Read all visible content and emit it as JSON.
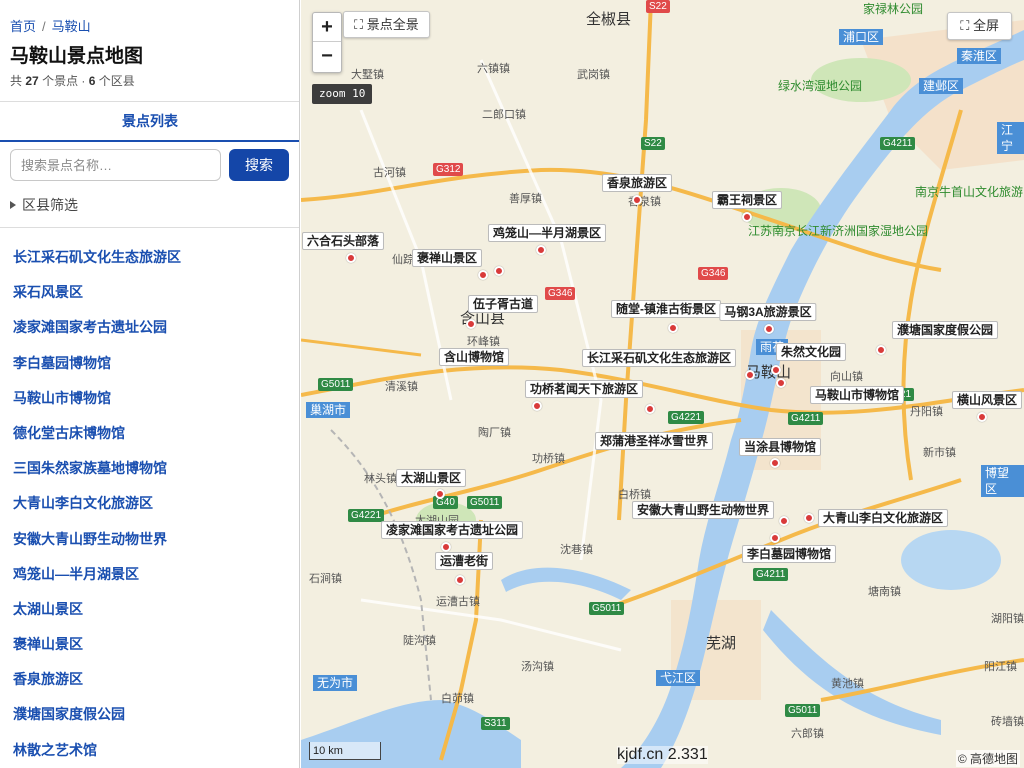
{
  "breadcrumb": {
    "home": "首页",
    "separator": "/",
    "current": "马鞍山"
  },
  "page": {
    "title": "马鞍山景点地图",
    "stats_prefix": "共",
    "spot_count": "27",
    "stats_mid": "个景点 ·",
    "district_count": "6",
    "stats_suffix": "个区县"
  },
  "tabs": {
    "spot_list": "景点列表"
  },
  "search": {
    "placeholder": "搜索景点名称…",
    "button": "搜索"
  },
  "filter": {
    "label": "区县筛选"
  },
  "spot_list": [
    "长江采石矶文化生态旅游区",
    "采石风景区",
    "凌家滩国家考古遗址公园",
    "李白墓园博物馆",
    "马鞍山市博物馆",
    "德化堂古床博物馆",
    "三国朱然家族墓地博物馆",
    "大青山李白文化旅游区",
    "安徽大青山野生动物世界",
    "鸡笼山—半月湖景区",
    "太湖山景区",
    "褒禅山景区",
    "香泉旅游区",
    "濮塘国家度假公园",
    "林散之艺术馆"
  ],
  "map": {
    "zoom_in": "+",
    "zoom_out": "−",
    "overview_button": "⛶ 景点全景",
    "fullscreen_button": "⛶ 全屏",
    "zoom_badge": "zoom 10",
    "scale": "10 km",
    "footer": "kjdf.cn 2.331",
    "attribution": "© 高德地图",
    "colors": {
      "water": "#a8cdf0",
      "land": "#f3efe0",
      "highway": "#f5b94a",
      "marker": "#d93a3a",
      "accent": "#1446a8"
    },
    "markers": [
      {
        "label": "六合石头部落"
      },
      {
        "label": "褒禅山景区"
      },
      {
        "label": "鸡笼山—半月湖景区"
      },
      {
        "label": "香泉旅游区"
      },
      {
        "label": "霸王祠景区"
      },
      {
        "label": "伍子胥古道"
      },
      {
        "label": "随堂-镇淮古街景区"
      },
      {
        "label": "马钢3A旅游景区"
      },
      {
        "label": "濮塘国家度假公园"
      },
      {
        "label": "含山博物馆"
      },
      {
        "label": "长江采石矶文化生态旅游区"
      },
      {
        "label": "朱然文化园"
      },
      {
        "label": "功桥茗闻天下旅游区"
      },
      {
        "label": "马鞍山市博物馆"
      },
      {
        "label": "横山风景区"
      },
      {
        "label": "郑蒲港圣祥冰雪世界"
      },
      {
        "label": "当涂县博物馆"
      },
      {
        "label": "太湖山景区"
      },
      {
        "label": "安徽大青山野生动物世界"
      },
      {
        "label": "大青山李白文化旅游区"
      },
      {
        "label": "凌家滩国家考古遗址公园"
      },
      {
        "label": "运漕老街"
      },
      {
        "label": "李白墓园博物馆"
      }
    ],
    "places": [
      "全椒县",
      "大墅镇",
      "六镇镇",
      "武岗镇",
      "二郎口镇",
      "古河镇",
      "善厚镇",
      "香泉镇",
      "仙踪镇",
      "含山县",
      "环峰镇",
      "清溪镇",
      "陶厂镇",
      "功桥镇",
      "林头镇",
      "太湖山园",
      "白桥镇",
      "沈巷镇",
      "石涧镇",
      "陡沟镇",
      "汤沟镇",
      "白茆镇",
      "运漕古镇",
      "芜湖",
      "向山镇",
      "丹阳镇",
      "新市镇",
      "塘南镇",
      "湖阳镇",
      "阳江镇",
      "黄池镇",
      "六郎镇",
      "砖墙镇",
      "马鞍山",
      "南京牛首山文化旅游区",
      "江苏南京长江新济洲国家湿地公园",
      "绿水湾湿地公园",
      "家禄林公园"
    ],
    "districts": [
      "浦口区",
      "建邺区",
      "秦淮区",
      "江宁",
      "巢湖市",
      "博望区",
      "无为市",
      "弋江区",
      "雨花"
    ],
    "roads": [
      "S22",
      "G40",
      "G312",
      "S22",
      "G346",
      "G346",
      "G4211",
      "G5011",
      "G4221",
      "G5011",
      "G4221",
      "G4211",
      "G4221",
      "G5011",
      "G5011",
      "G4211",
      "S311"
    ]
  }
}
